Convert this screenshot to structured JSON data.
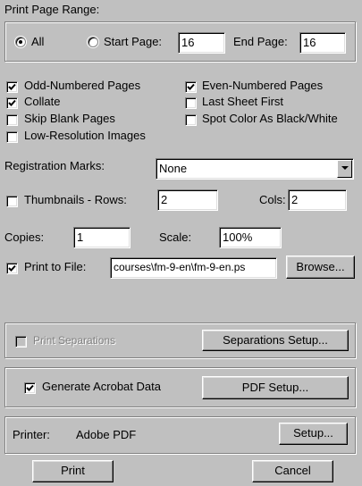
{
  "page_range": {
    "label": "Print Page Range:",
    "all_label": "All",
    "all_selected": true,
    "start_page_label": "Start Page:",
    "start_page_value": "16",
    "end_page_label": "End Page:",
    "end_page_value": "16"
  },
  "options": {
    "odd_pages": {
      "label": "Odd-Numbered Pages",
      "checked": true
    },
    "even_pages": {
      "label": "Even-Numbered Pages",
      "checked": true
    },
    "collate": {
      "label": "Collate",
      "checked": true
    },
    "last_sheet_first": {
      "label": "Last Sheet First",
      "checked": false
    },
    "skip_blank": {
      "label": "Skip Blank Pages",
      "checked": false
    },
    "spot_color": {
      "label": "Spot Color As Black/White",
      "checked": false
    },
    "low_res": {
      "label": "Low-Resolution Images",
      "checked": false
    }
  },
  "registration": {
    "label": "Registration Marks:",
    "value": "None"
  },
  "thumbnails": {
    "label": "Thumbnails - Rows:",
    "checked": false,
    "rows": "2",
    "cols_label": "Cols:",
    "cols": "2"
  },
  "copies": {
    "label": "Copies:",
    "value": "1"
  },
  "scale": {
    "label": "Scale:",
    "value": "100%"
  },
  "print_to_file": {
    "label": "Print to File:",
    "checked": true,
    "path": "courses\\fm-9-en\\fm-9-en.ps",
    "browse_label": "Browse..."
  },
  "separations": {
    "label": "Print Separations",
    "checked": false,
    "setup_label": "Separations Setup..."
  },
  "acrobat": {
    "label": "Generate Acrobat Data",
    "checked": true,
    "setup_label": "PDF Setup..."
  },
  "printer": {
    "label": "Printer:",
    "name": "Adobe PDF",
    "setup_label": "Setup..."
  },
  "actions": {
    "print_label": "Print",
    "cancel_label": "Cancel"
  }
}
